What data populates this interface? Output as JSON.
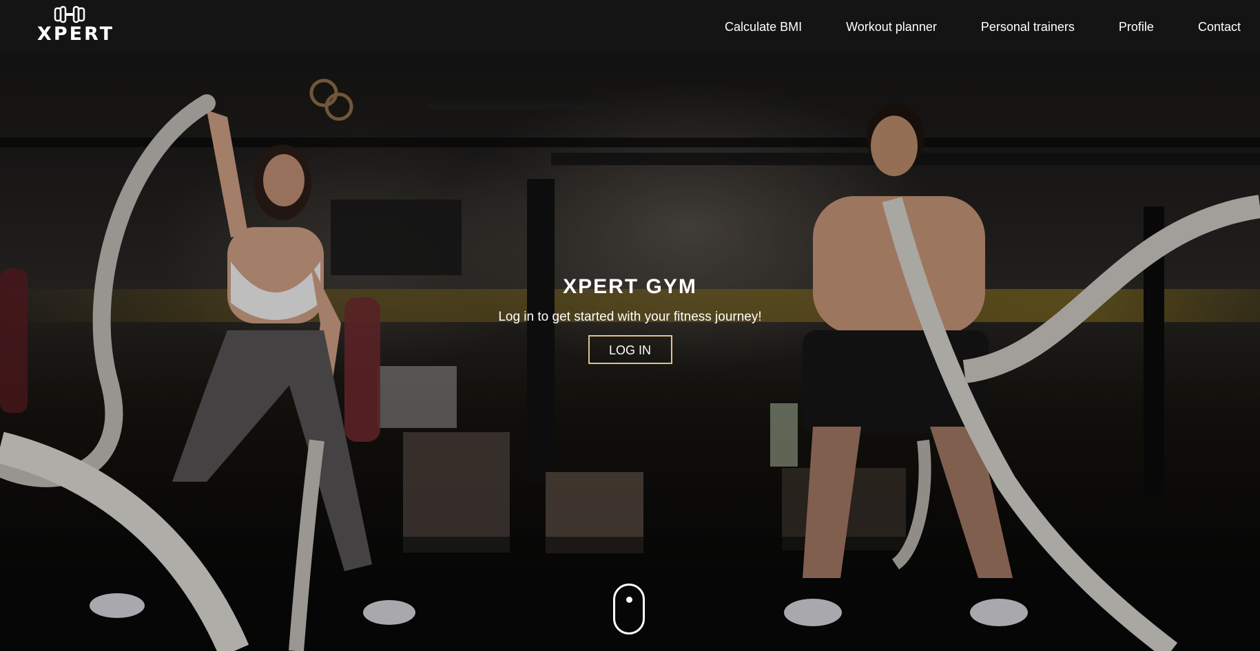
{
  "brand": {
    "logo_text": "XPERT",
    "logo_icon": "dumbbell-icon"
  },
  "nav": {
    "items": [
      {
        "label": "Calculate BMI"
      },
      {
        "label": "Workout planner"
      },
      {
        "label": "Personal trainers"
      },
      {
        "label": "Profile"
      },
      {
        "label": "Contact"
      }
    ]
  },
  "hero": {
    "title": "XPERT GYM",
    "subtitle": "Log in to get started with your fitness journey!",
    "login_label": "LOG IN",
    "background_image": "gym battle-ropes photo",
    "scroll_indicator_icon": "mouse-scroll-icon"
  },
  "colors": {
    "navbar_bg": "#141415",
    "text": "#ffffff",
    "button_border": "#e0c48a"
  }
}
